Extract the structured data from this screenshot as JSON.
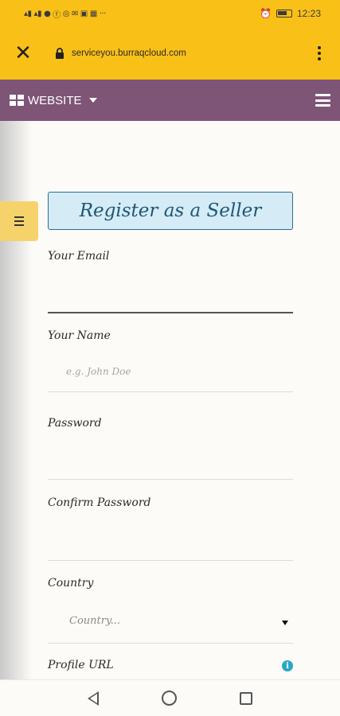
{
  "status_bar": {
    "left_icons": [
      "signal-icon",
      "signal-icon",
      "notification-icon",
      "facebook-icon",
      "whatsapp-icon",
      "mail-icon",
      "photo-icon",
      "linkedin-icon",
      "more-icon"
    ],
    "left_ellipsis": "···",
    "alarm_icon": "alarm-icon",
    "battery_icon": "battery-icon",
    "time": "12:23"
  },
  "browser": {
    "close_icon": "close-icon",
    "lock_icon": "lock-icon",
    "url": "serviceyou.burraqcloud.com",
    "menu_icon": "more-vertical-icon"
  },
  "site_nav": {
    "website_label": "WEBSITE",
    "grid_icon": "apps-grid-icon",
    "menu_icon": "hamburger-menu-icon",
    "background_color": "#7e5477"
  },
  "form": {
    "title": "Register as a Seller",
    "fields": {
      "email": {
        "label": "Your Email",
        "placeholder": ""
      },
      "name": {
        "label": "Your Name",
        "placeholder": "e.g. John Doe"
      },
      "password": {
        "label": "Password",
        "placeholder": ""
      },
      "confirm_password": {
        "label": "Confirm Password",
        "placeholder": ""
      },
      "country": {
        "label": "Country",
        "selected": "Country..."
      },
      "profile_url": {
        "label": "Profile URL",
        "info_icon": "info-icon"
      }
    }
  },
  "colors": {
    "browser_bar": "#f9c017",
    "title_bg": "#d5ebf6",
    "title_text": "#1e5676",
    "side_toggle": "#f6d36a",
    "info_icon": "#2aa7c4"
  },
  "system_nav": {
    "back_icon": "back-triangle-icon",
    "home_icon": "home-circle-icon",
    "recents_icon": "recents-square-icon"
  }
}
